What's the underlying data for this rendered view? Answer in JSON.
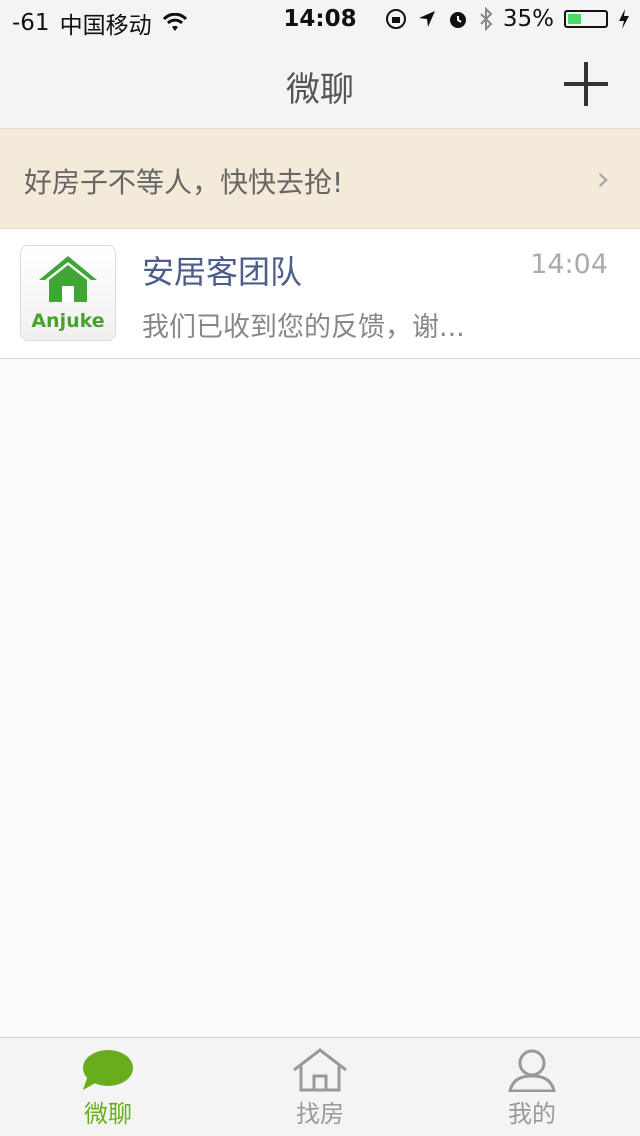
{
  "status_bar": {
    "signal": "-61",
    "carrier": "中国移动",
    "time": "14:08",
    "battery": "35%"
  },
  "nav": {
    "title": "微聊",
    "add_icon": "plus-icon"
  },
  "banner": {
    "text": "好房子不等人，快快去抢!",
    "chevron": "›"
  },
  "chats": [
    {
      "avatar_text": "Anjuke",
      "name": "安居客团队",
      "time": "14:04",
      "message": "我们已收到您的反馈，谢..."
    }
  ],
  "tabs": [
    {
      "label": "微聊",
      "icon": "chat-bubble-icon",
      "active": true
    },
    {
      "label": "找房",
      "icon": "house-icon",
      "active": false
    },
    {
      "label": "我的",
      "icon": "person-icon",
      "active": false
    }
  ],
  "colors": {
    "accent": "#6aad1c",
    "banner_bg": "#f3ead9",
    "name_color": "#4d5e8a",
    "battery_fill": "#4cd964"
  },
  "battery_level": 0.35
}
